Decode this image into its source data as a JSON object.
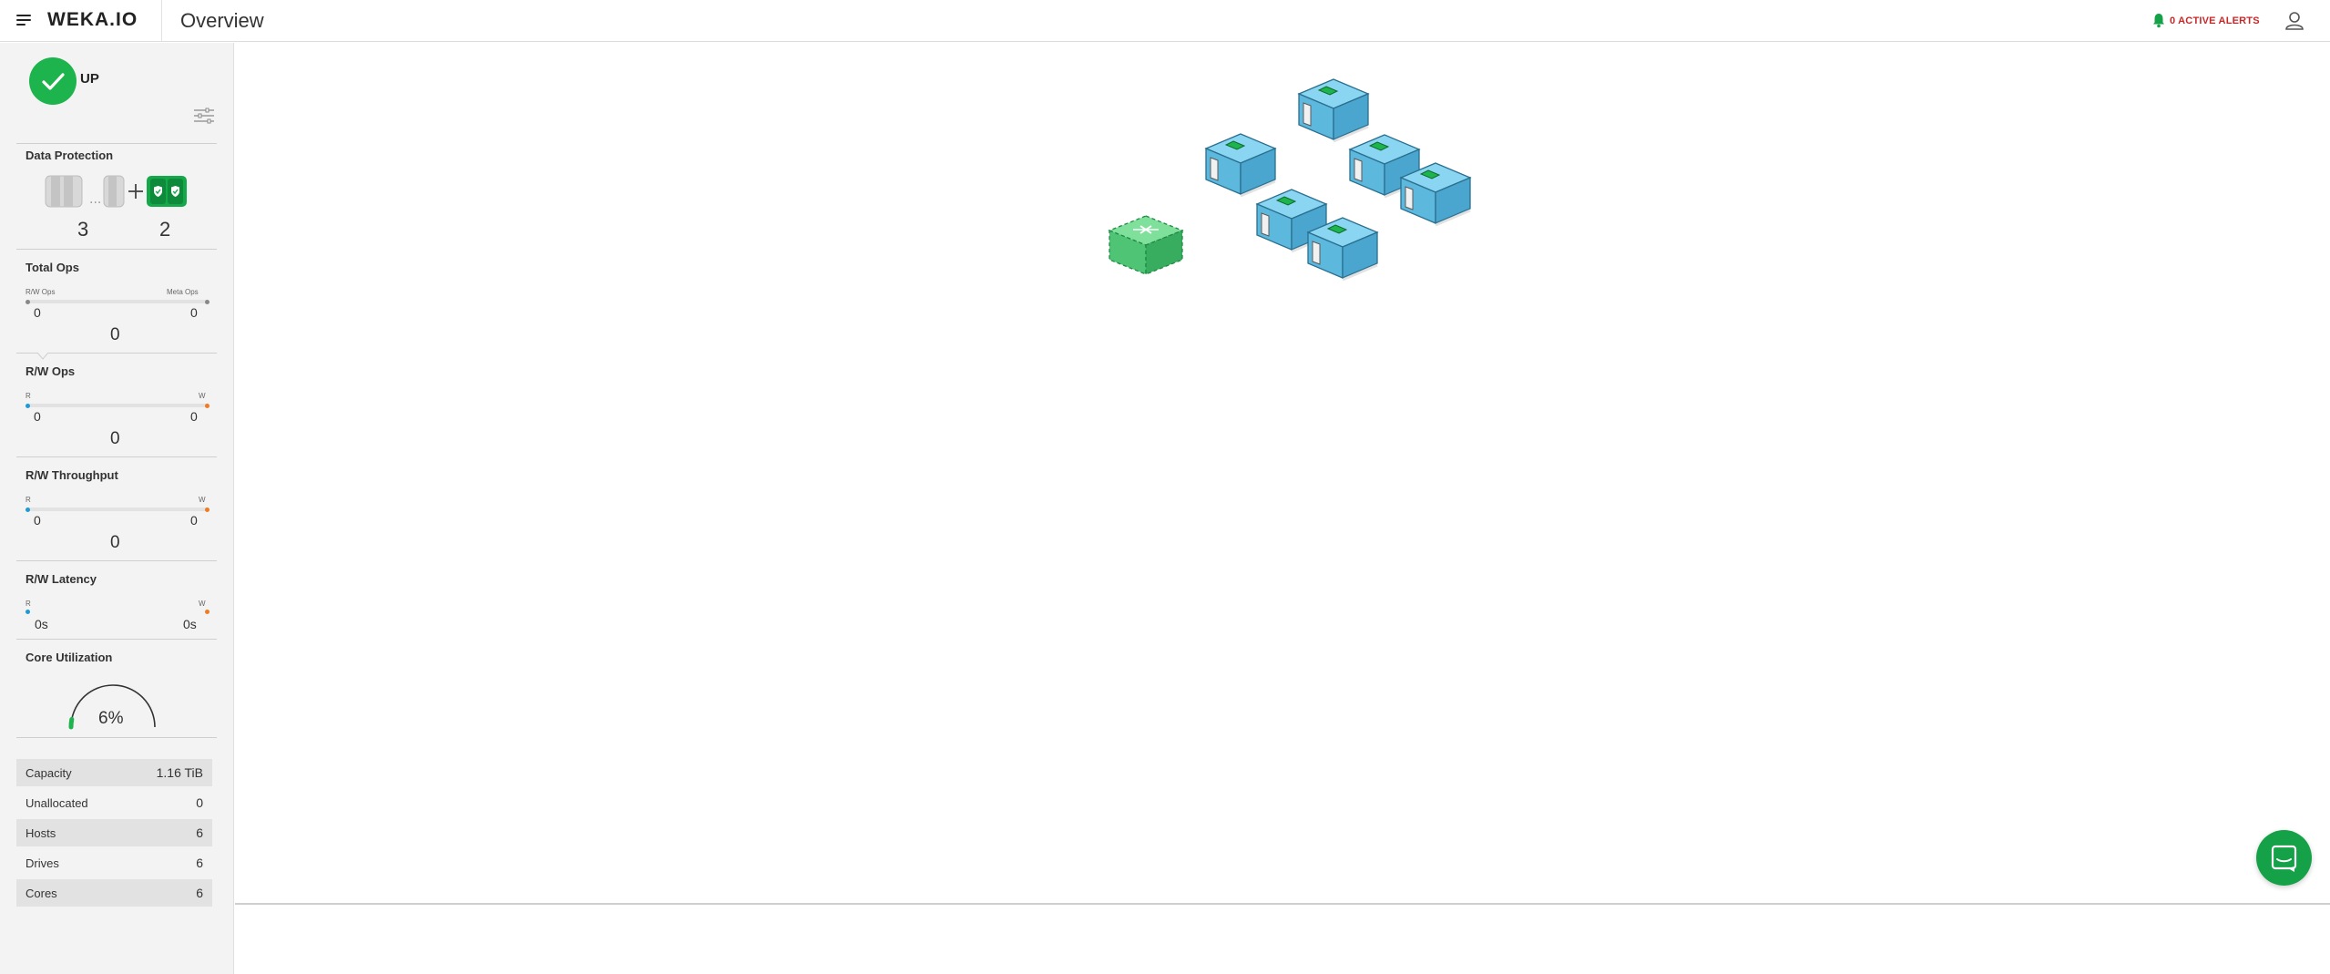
{
  "header": {
    "logo": "WEKA.IO",
    "title": "Overview",
    "alerts_label": "0 ACTIVE ALERTS"
  },
  "sidebar": {
    "status": "UP",
    "data_protection": {
      "title": "Data Protection",
      "data_drives": "3",
      "protection_drives": "2"
    },
    "total_ops": {
      "title": "Total Ops",
      "left_label": "R/W Ops",
      "right_label": "Meta Ops",
      "left_value": "0",
      "right_value": "0",
      "total": "0"
    },
    "rw_ops": {
      "title": "R/W Ops",
      "left_label": "R",
      "right_label": "W",
      "left_value": "0",
      "right_value": "0",
      "total": "0"
    },
    "rw_throughput": {
      "title": "R/W Throughput",
      "left_label": "R",
      "right_label": "W",
      "left_value": "0",
      "right_value": "0",
      "total": "0"
    },
    "rw_latency": {
      "title": "R/W Latency",
      "left_label": "R",
      "right_label": "W",
      "left_value": "0s",
      "right_value": "0s"
    },
    "core_utilization": {
      "title": "Core Utilization",
      "value": "6%",
      "fraction": 0.06
    },
    "stats": [
      {
        "label": "Capacity",
        "value": "1.16 TiB"
      },
      {
        "label": "Unallocated",
        "value": "0"
      },
      {
        "label": "Hosts",
        "value": "6"
      },
      {
        "label": "Drives",
        "value": "6"
      },
      {
        "label": "Cores",
        "value": "6"
      }
    ]
  },
  "colors": {
    "status_green": "#1db44d",
    "read_blue": "#1e9ad6",
    "write_orange": "#f07b22",
    "alert_red": "#c62828",
    "host_blue": "#6cc4e8",
    "backend_green": "#5fcf7e"
  }
}
